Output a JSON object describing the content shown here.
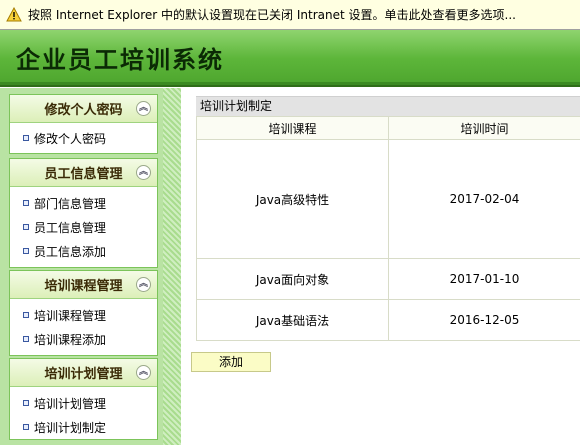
{
  "infobar": {
    "icon": "warning-shield-icon",
    "text": "按照 Internet Explorer 中的默认设置现在已关闭 Intranet 设置。单击此处查看更多选项..."
  },
  "header": {
    "title": "企业员工培训系统"
  },
  "sidebar": {
    "groups": [
      {
        "title": "修改个人密码",
        "items": [
          "修改个人密码"
        ]
      },
      {
        "title": "员工信息管理",
        "items": [
          "部门信息管理",
          "员工信息管理",
          "员工信息添加"
        ]
      },
      {
        "title": "培训课程管理",
        "items": [
          "培训课程管理",
          "培训课程添加"
        ]
      },
      {
        "title": "培训计划管理",
        "items": [
          "培训计划管理",
          "培训计划制定"
        ]
      }
    ],
    "collapse_glyph": "︽"
  },
  "main": {
    "panel_title": "培训计划制定",
    "columns": [
      "培训课程",
      "培训时间"
    ],
    "rows": [
      [
        "Java高级特性",
        "2017-02-04"
      ],
      [
        "Java面向对象",
        "2017-01-10"
      ],
      [
        "Java基础语法",
        "2016-12-05"
      ]
    ],
    "add_label": "添加"
  },
  "colors": {
    "header_green": "#5db63a",
    "sidebar_green": "#b9e3a3",
    "infobar_yellow": "#ffffe1",
    "add_button_bg": "#fbfcc6"
  }
}
